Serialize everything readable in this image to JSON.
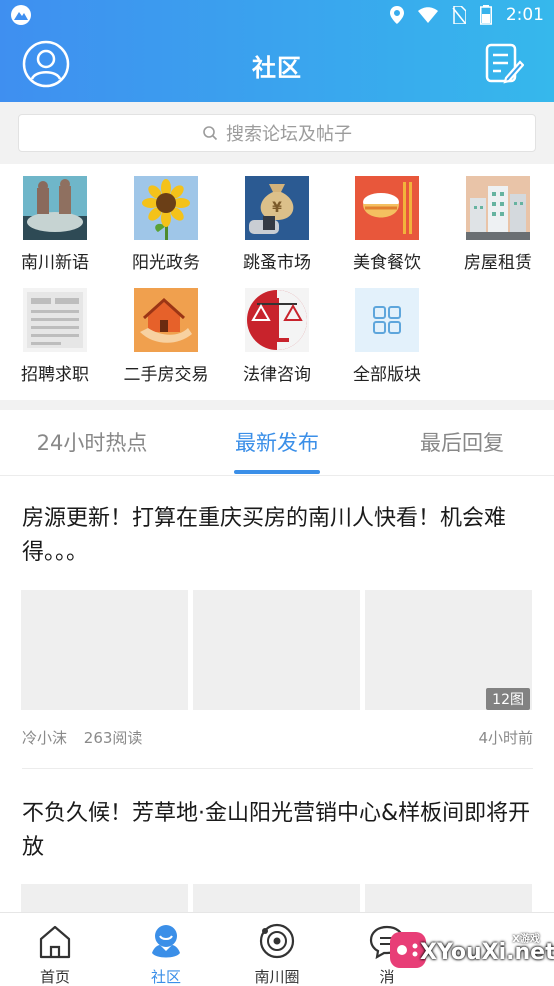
{
  "status_bar": {
    "time": "2:01"
  },
  "header": {
    "title": "社区"
  },
  "search": {
    "placeholder": "搜索论坛及帖子"
  },
  "categories": [
    {
      "label": "南川新语",
      "icon": "statue-icon"
    },
    {
      "label": "阳光政务",
      "icon": "sunflower-icon"
    },
    {
      "label": "跳蚤市场",
      "icon": "money-bag-icon"
    },
    {
      "label": "美食餐饮",
      "icon": "rice-bowl-icon"
    },
    {
      "label": "房屋租赁",
      "icon": "buildings-icon"
    },
    {
      "label": "招聘求职",
      "icon": "newspaper-icon"
    },
    {
      "label": "二手房交易",
      "icon": "house-in-hand-icon"
    },
    {
      "label": "法律咨询",
      "icon": "scales-icon"
    },
    {
      "label": "全部版块",
      "icon": "grid-icon"
    }
  ],
  "tabs": [
    {
      "label": "24小时热点",
      "active": false
    },
    {
      "label": "最新发布",
      "active": true
    },
    {
      "label": "最后回复",
      "active": false
    }
  ],
  "posts": [
    {
      "title": "房源更新！打算在重庆买房的南川人快看！机会难得。。。",
      "image_count": "12图",
      "author": "冷小沫",
      "reads": "263阅读",
      "time": "4小时前"
    },
    {
      "title": "不负久候！芳草地·金山阳光营销中心&样板间即将开放"
    }
  ],
  "bottom_nav": [
    {
      "label": "首页",
      "icon": "home-icon",
      "active": false
    },
    {
      "label": "社区",
      "icon": "community-icon",
      "active": true
    },
    {
      "label": "南川圈",
      "icon": "circle-icon",
      "active": false
    },
    {
      "label": "消",
      "icon": "message-icon",
      "active": false
    }
  ],
  "watermark": {
    "text": "XYouXi.net",
    "small": "X游戏"
  },
  "colors": {
    "accent": "#3b8fe8",
    "header_start": "#3f8ff0",
    "header_end": "#36b8ec"
  }
}
